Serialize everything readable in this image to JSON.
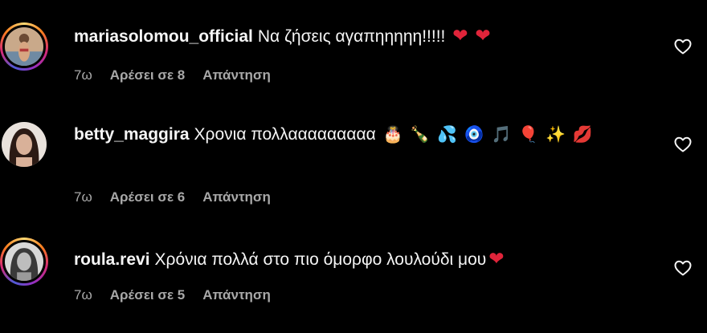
{
  "comments": [
    {
      "username": "mariasolomou_official",
      "text": "Να ζήσεις αγαπηηηηη!!!!!",
      "emojis": [
        "❤",
        "❤"
      ],
      "time": "7ω",
      "likes_label": "Αρέσει σε 8",
      "reply_label": "Απάντηση",
      "has_story_ring": true
    },
    {
      "username": "betty_maggira",
      "text": "Χρονια πολλααααααααα",
      "emojis": [
        "🎂",
        "🍾",
        "💦",
        "🧿",
        "🎵",
        "🎈",
        "✨",
        "💋"
      ],
      "time": "7ω",
      "likes_label": "Αρέσει σε 6",
      "reply_label": "Απάντηση",
      "has_story_ring": false
    },
    {
      "username": "roula.revi",
      "text": "Χρόνια πολλά στο πιο όμορφο λουλούδι μου",
      "emojis": [
        "❤"
      ],
      "time": "7ω",
      "likes_label": "Αρέσει σε 5",
      "reply_label": "Απάντηση",
      "has_story_ring": true
    }
  ],
  "icons": {
    "like": "heart-outline-icon"
  },
  "colors": {
    "background": "#000000",
    "text": "#f5f5f5",
    "meta": "#a8a8a8",
    "heart": "#e0243a"
  }
}
